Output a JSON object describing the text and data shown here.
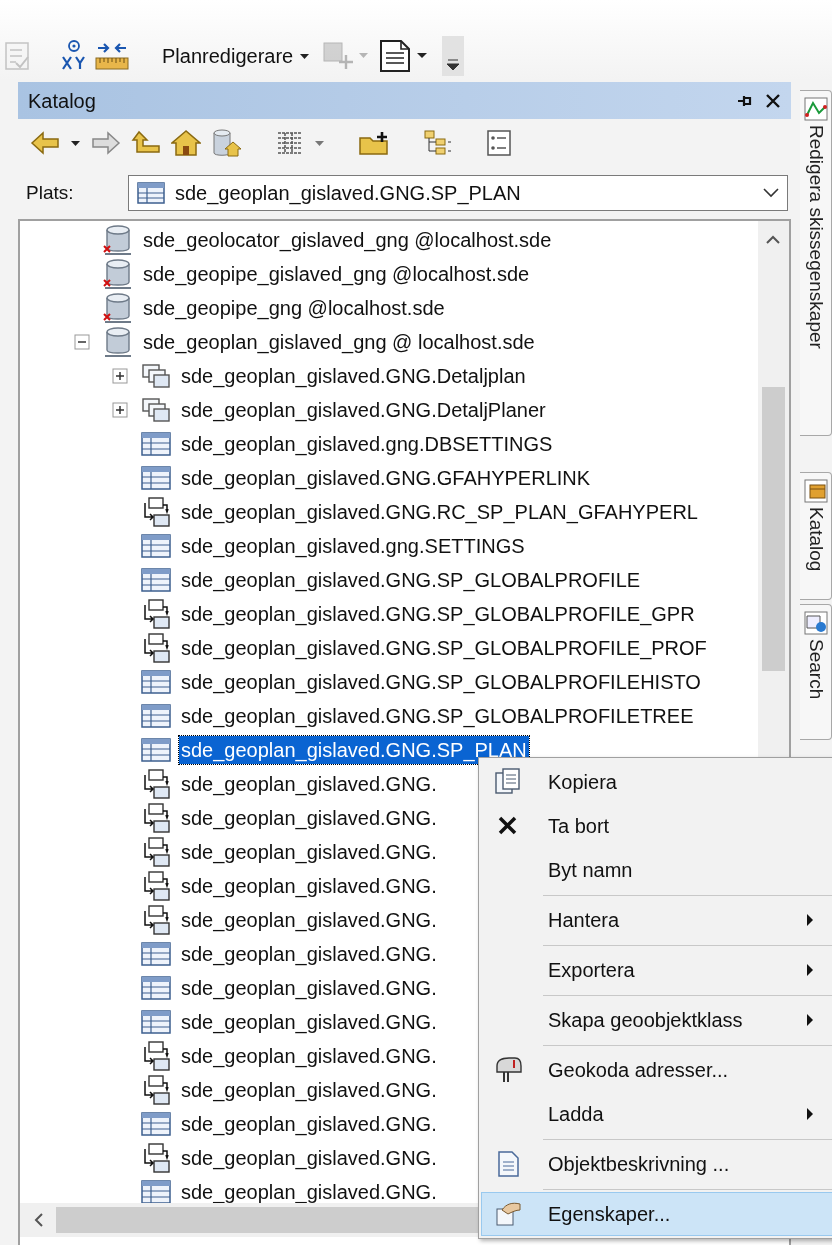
{
  "toolbar": [
    {
      "kind": "check",
      "disabled": true
    },
    {
      "kind": "xy",
      "disabled": false
    },
    {
      "kind": "measure",
      "disabled": false
    },
    {
      "kind": "editor",
      "label": "Planredigerare",
      "disabled": false
    },
    {
      "kind": "add-feature",
      "disabled": true
    },
    {
      "kind": "document",
      "disabled": false
    }
  ],
  "catalog": {
    "title": "Katalog",
    "location_label": "Plats:",
    "location_value": "sde_geoplan_gislaved.GNG.SP_PLAN",
    "tree": [
      {
        "label": "sde_geolocator_gislaved_gng @localhost.sde",
        "kind": "database-error",
        "selected": false
      },
      {
        "label": "sde_geopipe_gislaved_gng @localhost.sde",
        "kind": "database-error",
        "selected": false
      },
      {
        "label": "sde_geopipe_gng @localhost.sde",
        "kind": "database-error",
        "selected": false
      },
      {
        "label": "sde_geoplan_gislaved_gng @ localhost.sde",
        "kind": "database",
        "selected": false,
        "expanded": true,
        "children": [
          {
            "label": "sde_geoplan_gislaved.GNG.Detaljplan",
            "kind": "dataset",
            "selected": false,
            "expanded": false
          },
          {
            "label": "sde_geoplan_gislaved.GNG.DetaljPlaner",
            "kind": "dataset",
            "selected": false,
            "expanded": false
          },
          {
            "label": "sde_geoplan_gislaved.gng.DBSETTINGS",
            "kind": "table",
            "selected": false
          },
          {
            "label": "sde_geoplan_gislaved.GNG.GFAHYPERLINK",
            "kind": "table",
            "selected": false
          },
          {
            "label": "sde_geoplan_gislaved.GNG.RC_SP_PLAN_GFAHYPERL",
            "kind": "relationship",
            "selected": false
          },
          {
            "label": "sde_geoplan_gislaved.gng.SETTINGS",
            "kind": "table",
            "selected": false
          },
          {
            "label": "sde_geoplan_gislaved.GNG.SP_GLOBALPROFILE",
            "kind": "table",
            "selected": false
          },
          {
            "label": "sde_geoplan_gislaved.GNG.SP_GLOBALPROFILE_GPR",
            "kind": "relationship",
            "selected": false
          },
          {
            "label": "sde_geoplan_gislaved.GNG.SP_GLOBALPROFILE_PROF",
            "kind": "relationship",
            "selected": false
          },
          {
            "label": "sde_geoplan_gislaved.GNG.SP_GLOBALPROFILEHISTO",
            "kind": "table",
            "selected": false
          },
          {
            "label": "sde_geoplan_gislaved.GNG.SP_GLOBALPROFILETREE",
            "kind": "table",
            "selected": false
          },
          {
            "label": "sde_geoplan_gislaved.GNG.SP_PLAN",
            "kind": "table",
            "selected": true
          },
          {
            "label": "sde_geoplan_gislaved.GNG.",
            "kind": "relationship",
            "selected": false
          },
          {
            "label": "sde_geoplan_gislaved.GNG.",
            "kind": "relationship",
            "selected": false
          },
          {
            "label": "sde_geoplan_gislaved.GNG.",
            "kind": "relationship",
            "selected": false
          },
          {
            "label": "sde_geoplan_gislaved.GNG.",
            "kind": "relationship",
            "selected": false
          },
          {
            "label": "sde_geoplan_gislaved.GNG.",
            "kind": "relationship",
            "selected": false
          },
          {
            "label": "sde_geoplan_gislaved.GNG.",
            "kind": "table",
            "selected": false
          },
          {
            "label": "sde_geoplan_gislaved.GNG.",
            "kind": "table",
            "selected": false
          },
          {
            "label": "sde_geoplan_gislaved.GNG.",
            "kind": "table",
            "selected": false
          },
          {
            "label": "sde_geoplan_gislaved.GNG.",
            "kind": "relationship",
            "selected": false
          },
          {
            "label": "sde_geoplan_gislaved.GNG.",
            "kind": "relationship",
            "selected": false
          },
          {
            "label": "sde_geoplan_gislaved.GNG.",
            "kind": "table",
            "selected": false
          },
          {
            "label": "sde_geoplan_gislaved.GNG.",
            "kind": "relationship",
            "selected": false
          },
          {
            "label": "sde_geoplan_gislaved.GNG.",
            "kind": "table",
            "selected": false
          }
        ]
      }
    ]
  },
  "side_tabs": [
    {
      "label": "Redigera skissegenskaper",
      "kind": "sketch"
    },
    {
      "label": "Katalog",
      "kind": "catalog"
    },
    {
      "label": "Search",
      "kind": "search"
    }
  ],
  "context_menu": [
    {
      "label": "Kopiera",
      "kind": "copy",
      "submenu": false,
      "separator_before": false,
      "selected": false
    },
    {
      "label": "Ta bort",
      "kind": "delete",
      "submenu": false,
      "separator_before": false,
      "selected": false
    },
    {
      "label": "Byt namn",
      "kind": "plain",
      "submenu": false,
      "separator_before": false,
      "selected": false
    },
    {
      "label": "Hantera",
      "kind": "plain",
      "submenu": true,
      "separator_before": true,
      "selected": false
    },
    {
      "label": "Exportera",
      "kind": "plain",
      "submenu": true,
      "separator_before": true,
      "selected": false
    },
    {
      "label": "Skapa geoobjektklass",
      "kind": "plain",
      "submenu": true,
      "separator_before": true,
      "selected": false
    },
    {
      "label": "Geokoda adresser...",
      "kind": "geocode",
      "submenu": false,
      "separator_before": true,
      "selected": false
    },
    {
      "label": "Ladda",
      "kind": "plain",
      "submenu": true,
      "separator_before": false,
      "selected": false
    },
    {
      "label": "Objektbeskrivning ...",
      "kind": "document",
      "submenu": false,
      "separator_before": true,
      "selected": false
    },
    {
      "label": "Egenskaper...",
      "kind": "properties",
      "submenu": false,
      "separator_before": true,
      "selected": true
    }
  ]
}
